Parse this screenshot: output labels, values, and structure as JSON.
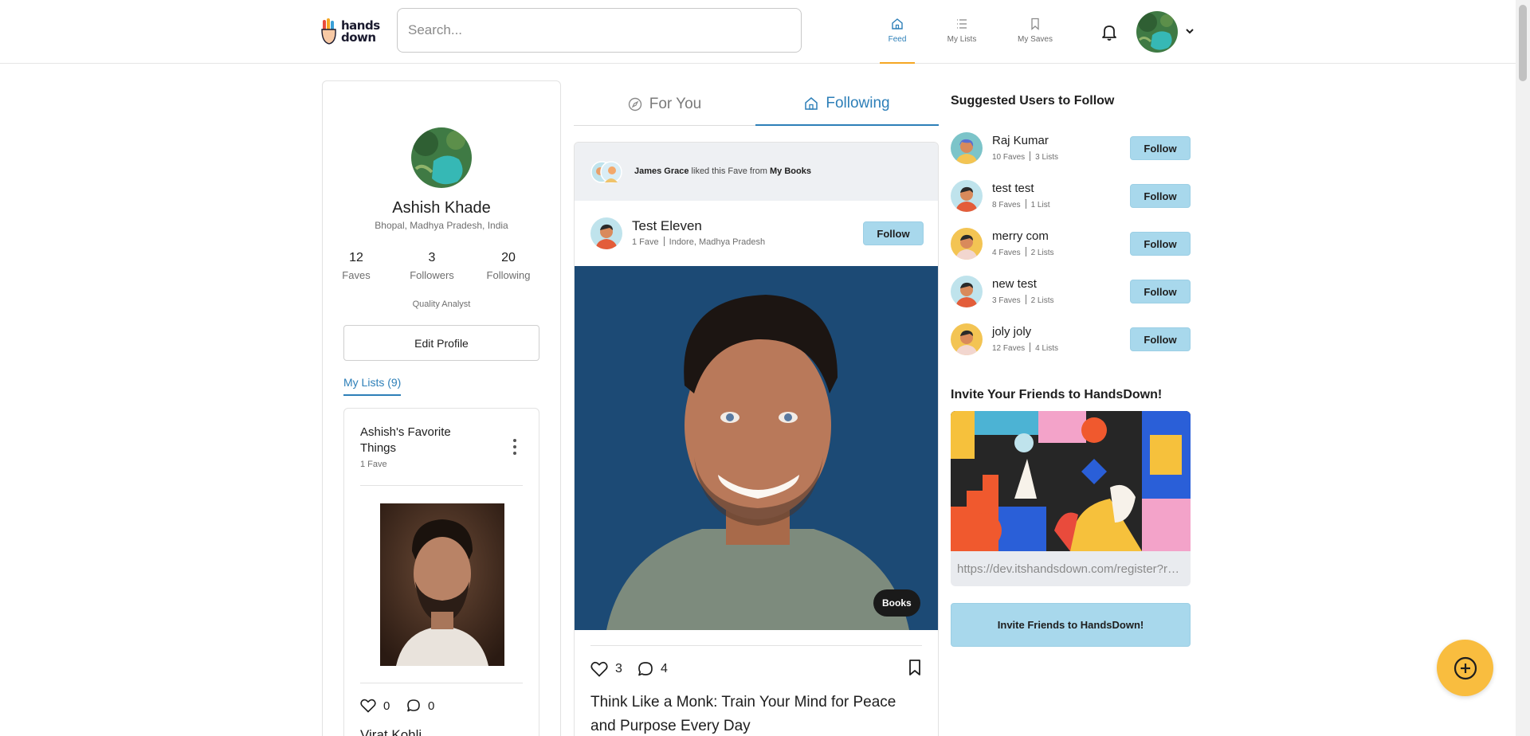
{
  "header": {
    "logo_text_1": "hands",
    "logo_text_2": "down",
    "search_placeholder": "Search...",
    "nav": [
      {
        "label": "Feed",
        "icon": "home-icon",
        "active": true
      },
      {
        "label": "My Lists",
        "icon": "list-icon",
        "active": false
      },
      {
        "label": "My Saves",
        "icon": "bookmark-icon",
        "active": false
      }
    ],
    "bell_icon": "bell-icon",
    "caret_icon": "chevron-down-icon"
  },
  "profile": {
    "name": "Ashish Khade",
    "location": "Bhopal, Madhya Pradesh, India",
    "stats": [
      {
        "value": "12",
        "label": "Faves"
      },
      {
        "value": "3",
        "label": "Followers"
      },
      {
        "value": "20",
        "label": "Following"
      }
    ],
    "role": "Quality Analyst",
    "edit_label": "Edit Profile",
    "lists_tab": "My Lists (9)",
    "list": {
      "title": "Ashish's Favorite Things",
      "count": "1 Fave",
      "likes": "0",
      "comments": "0",
      "item_name": "Virat Kohli"
    }
  },
  "feed": {
    "tabs": [
      {
        "label": "For You",
        "icon": "compass-icon",
        "active": false
      },
      {
        "label": "Following",
        "icon": "home-icon",
        "active": true
      }
    ],
    "post": {
      "activity_user": "James Grace",
      "activity_mid": " liked this Fave from ",
      "activity_list": "My Books",
      "author_name": "Test Eleven",
      "author_faves": "1 Fave",
      "author_location": "Indore, Madhya Pradesh",
      "follow_label": "Follow",
      "badge": "Books",
      "likes": "3",
      "comments": "4",
      "title": "Think Like a Monk: Train Your Mind for Peace and Purpose Every Day"
    }
  },
  "suggested": {
    "heading": "Suggested Users to Follow",
    "follow_label": "Follow",
    "users": [
      {
        "name": "Raj Kumar",
        "faves": "10 Faves",
        "lists": "3 Lists",
        "bg": "#7cc4c9"
      },
      {
        "name": "test test",
        "faves": "8 Faves",
        "lists": "1 List",
        "bg": "#bfe3ec"
      },
      {
        "name": "merry com",
        "faves": "4 Faves",
        "lists": "2 Lists",
        "bg": "#f3c453"
      },
      {
        "name": "new test",
        "faves": "3 Faves",
        "lists": "2 Lists",
        "bg": "#bfe3ec"
      },
      {
        "name": "joly joly",
        "faves": "12 Faves",
        "lists": "4 Lists",
        "bg": "#f3c453"
      }
    ]
  },
  "invite": {
    "heading": "Invite Your Friends to HandsDown!",
    "url": "https://dev.itshandsdown.com/register?ref=ashish",
    "button_label": "Invite Friends to HandsDown!"
  },
  "colors": {
    "accent_blue": "#2d7fb8",
    "follow_bg": "#a8d8ec",
    "nav_underline": "#f5a623",
    "fab": "#f9bd3f"
  }
}
